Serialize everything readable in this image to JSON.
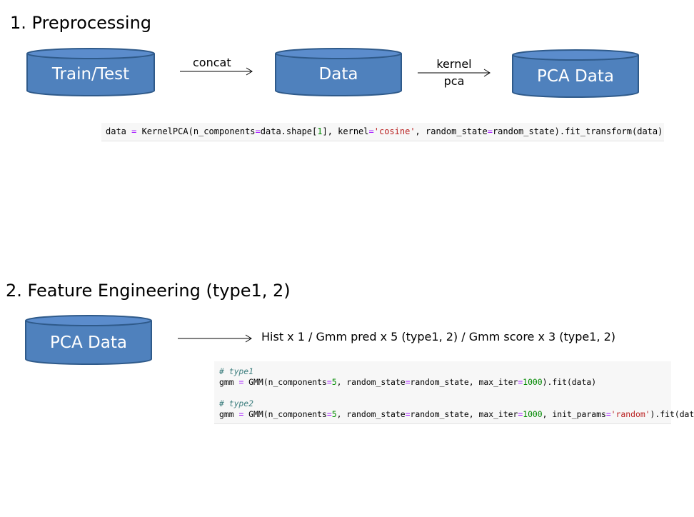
{
  "section1": {
    "heading": "1. Preprocessing",
    "nodes": {
      "train_test": "Train/Test",
      "data": "Data",
      "pca_data": "PCA Data"
    },
    "edge_concat": "concat",
    "edge_kernel_line1": "kernel",
    "edge_kernel_line2": "pca",
    "code": {
      "l1a": "data ",
      "l1eq": "=",
      "l1b": " KernelPCA(n_components",
      "l1eq2": "=",
      "l1c": "data.shape[",
      "l1num": "1",
      "l1d": "], kernel",
      "l1eq3": "=",
      "l1str": "'cosine'",
      "l1e": ", random_state",
      "l1eq4": "=",
      "l1f": "random_state).fit_transform(data)"
    }
  },
  "section2": {
    "heading": "2. Feature Engineering (type1, 2)",
    "node": "PCA Data",
    "description": "Hist x 1 / Gmm pred x 5 (type1, 2) / Gmm score x 3 (type1, 2)",
    "code": {
      "c1": "# type1",
      "g1a": "gmm ",
      "eq": "=",
      "g1b": " GMM(n_components",
      "num5": "5",
      "g1c": ", random_state",
      "g1d": "random_state, max_iter",
      "num1000": "1000",
      "g1e": ").fit(data)",
      "c2": "# type2",
      "g2e": ", init_params",
      "str_random": "'random'",
      "g2f": ").fit(data)"
    }
  },
  "colors": {
    "cylinder_fill": "#4f81bd",
    "cylinder_stroke": "#2f5a8a",
    "cylinder_top": "#5b8ccc"
  }
}
